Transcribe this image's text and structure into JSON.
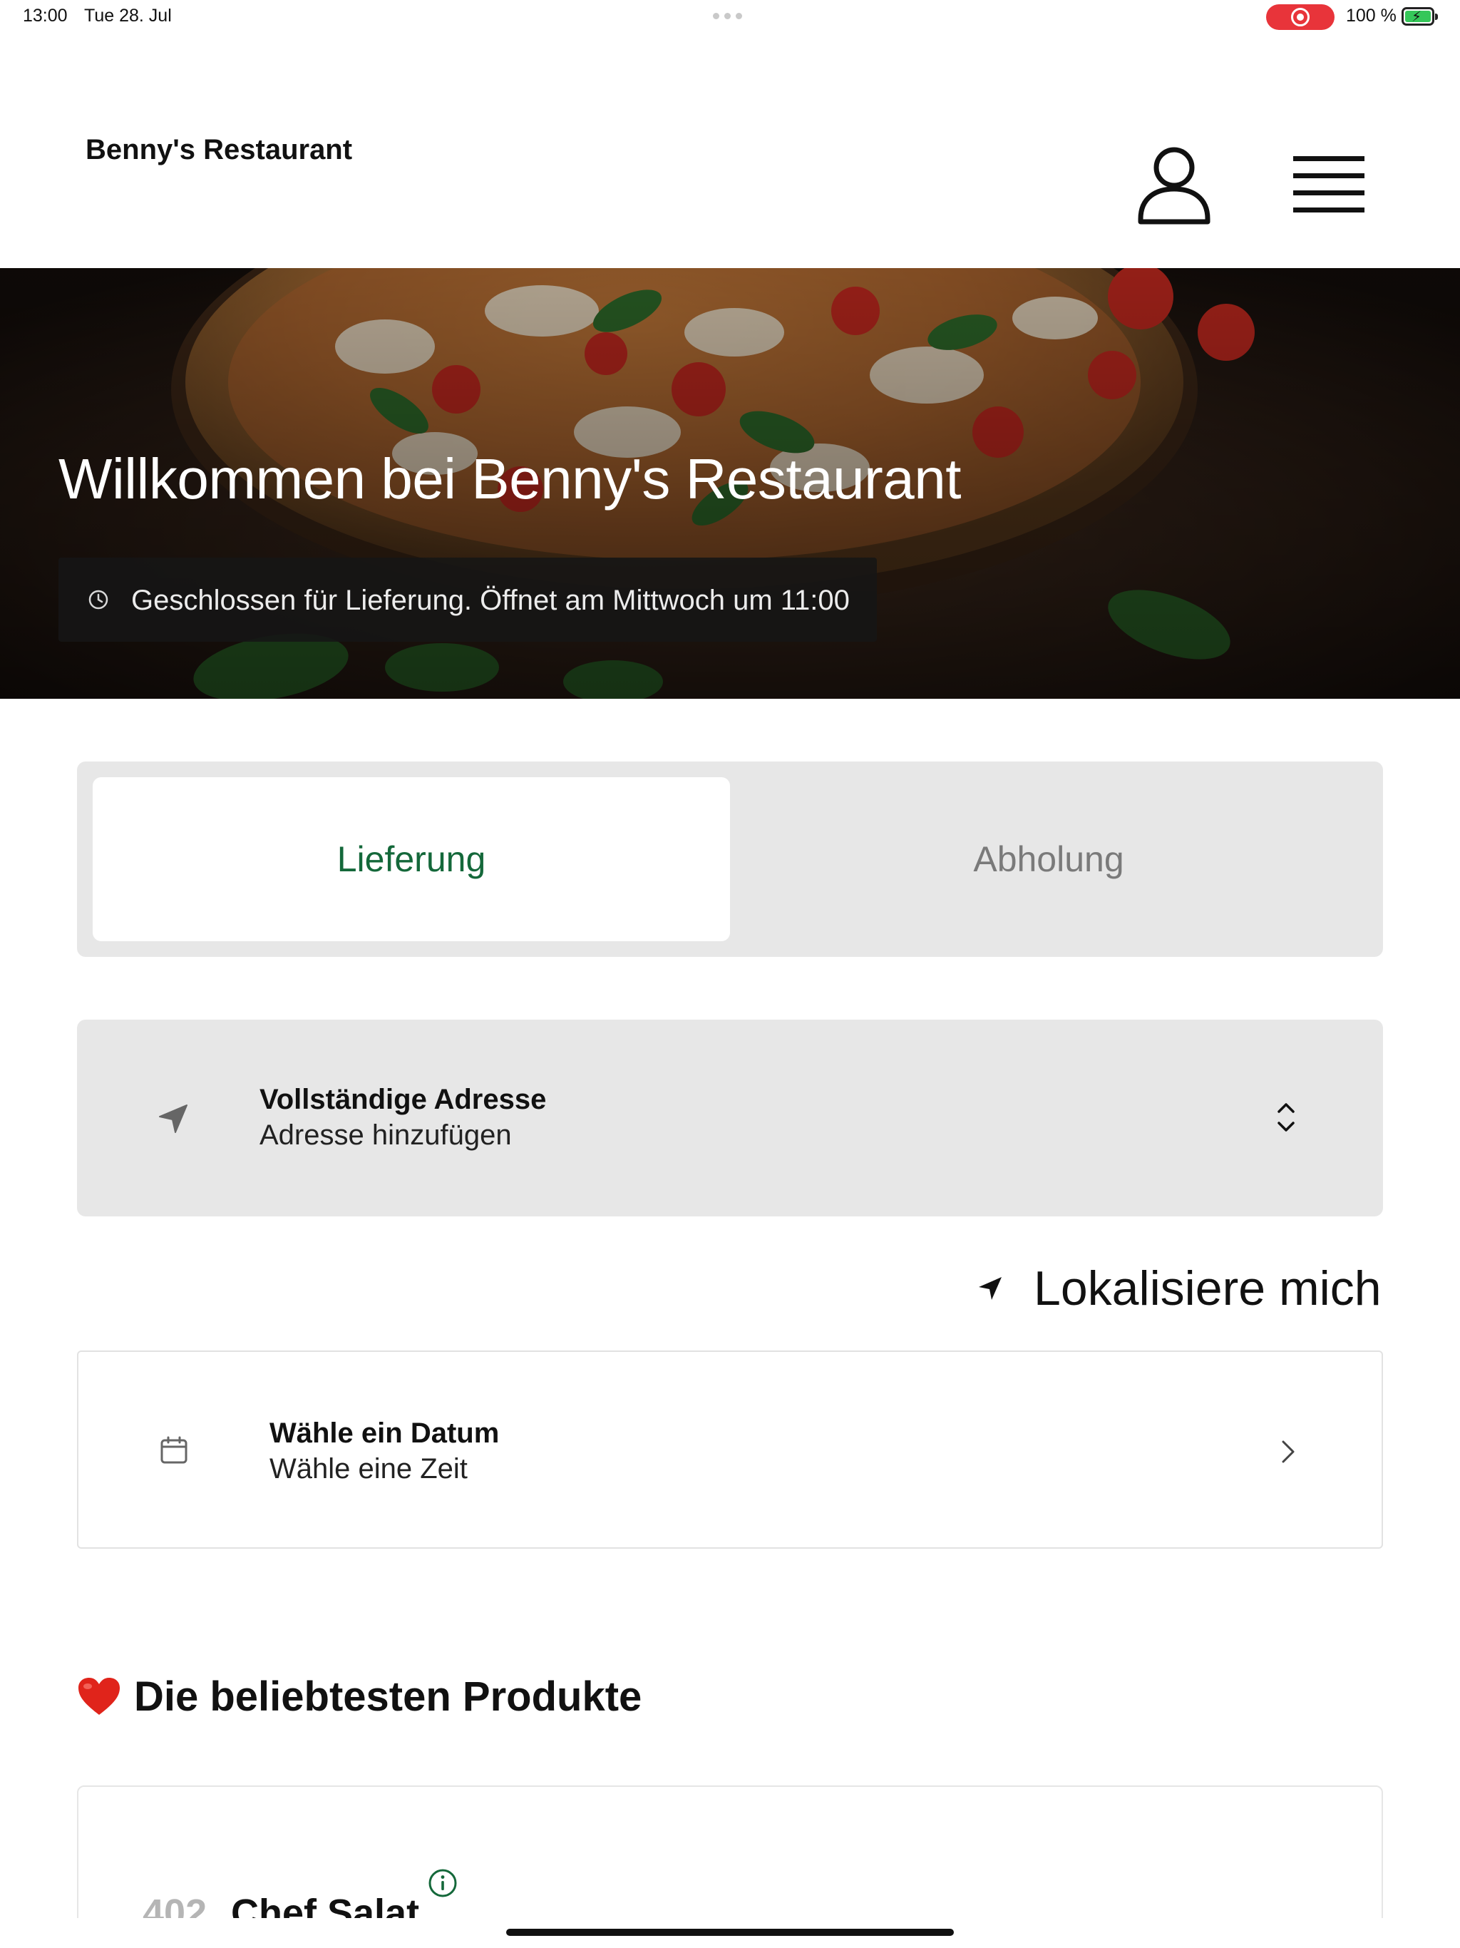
{
  "status_bar": {
    "time": "13:00",
    "date": "Tue 28. Jul",
    "battery_text": "100 %",
    "recording_color": "#e8343a",
    "battery_color": "#35c759"
  },
  "header": {
    "brand": "Benny's Restaurant",
    "account_icon": "person-icon",
    "menu_icon": "hamburger-menu-icon"
  },
  "hero": {
    "title": "Willkommen bei Benny's Restaurant",
    "status_text": "Geschlossen für Lieferung. Öffnet am Mittwoch um 11:00",
    "status_icon": "clock-icon"
  },
  "order_mode": {
    "tabs": [
      {
        "label": "Lieferung",
        "active": true
      },
      {
        "label": "Abholung",
        "active": false
      }
    ],
    "accent_color": "#14683a"
  },
  "address": {
    "title": "Vollständige Adresse",
    "subtitle": "Adresse hinzufügen",
    "icon": "location-arrow-icon"
  },
  "locate": {
    "label": "Lokalisiere mich",
    "icon": "location-arrow-icon"
  },
  "schedule": {
    "title": "Wähle ein Datum",
    "subtitle": "Wähle eine Zeit",
    "icon": "calendar-icon"
  },
  "popular": {
    "title": "Die beliebtesten Produkte",
    "icon": "heart-icon",
    "products": [
      {
        "number": "402",
        "name": "Chef Salat"
      }
    ]
  }
}
